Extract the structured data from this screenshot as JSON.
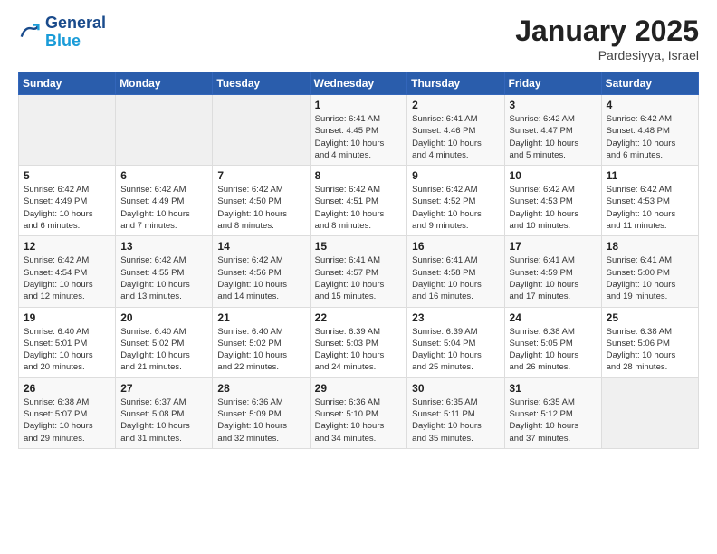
{
  "header": {
    "logo_line1": "General",
    "logo_line2": "Blue",
    "month_title": "January 2025",
    "subtitle": "Pardesiyya, Israel"
  },
  "weekdays": [
    "Sunday",
    "Monday",
    "Tuesday",
    "Wednesday",
    "Thursday",
    "Friday",
    "Saturday"
  ],
  "weeks": [
    [
      {
        "day": "",
        "info": ""
      },
      {
        "day": "",
        "info": ""
      },
      {
        "day": "",
        "info": ""
      },
      {
        "day": "1",
        "info": "Sunrise: 6:41 AM\nSunset: 4:45 PM\nDaylight: 10 hours\nand 4 minutes."
      },
      {
        "day": "2",
        "info": "Sunrise: 6:41 AM\nSunset: 4:46 PM\nDaylight: 10 hours\nand 4 minutes."
      },
      {
        "day": "3",
        "info": "Sunrise: 6:42 AM\nSunset: 4:47 PM\nDaylight: 10 hours\nand 5 minutes."
      },
      {
        "day": "4",
        "info": "Sunrise: 6:42 AM\nSunset: 4:48 PM\nDaylight: 10 hours\nand 6 minutes."
      }
    ],
    [
      {
        "day": "5",
        "info": "Sunrise: 6:42 AM\nSunset: 4:49 PM\nDaylight: 10 hours\nand 6 minutes."
      },
      {
        "day": "6",
        "info": "Sunrise: 6:42 AM\nSunset: 4:49 PM\nDaylight: 10 hours\nand 7 minutes."
      },
      {
        "day": "7",
        "info": "Sunrise: 6:42 AM\nSunset: 4:50 PM\nDaylight: 10 hours\nand 8 minutes."
      },
      {
        "day": "8",
        "info": "Sunrise: 6:42 AM\nSunset: 4:51 PM\nDaylight: 10 hours\nand 8 minutes."
      },
      {
        "day": "9",
        "info": "Sunrise: 6:42 AM\nSunset: 4:52 PM\nDaylight: 10 hours\nand 9 minutes."
      },
      {
        "day": "10",
        "info": "Sunrise: 6:42 AM\nSunset: 4:53 PM\nDaylight: 10 hours\nand 10 minutes."
      },
      {
        "day": "11",
        "info": "Sunrise: 6:42 AM\nSunset: 4:53 PM\nDaylight: 10 hours\nand 11 minutes."
      }
    ],
    [
      {
        "day": "12",
        "info": "Sunrise: 6:42 AM\nSunset: 4:54 PM\nDaylight: 10 hours\nand 12 minutes."
      },
      {
        "day": "13",
        "info": "Sunrise: 6:42 AM\nSunset: 4:55 PM\nDaylight: 10 hours\nand 13 minutes."
      },
      {
        "day": "14",
        "info": "Sunrise: 6:42 AM\nSunset: 4:56 PM\nDaylight: 10 hours\nand 14 minutes."
      },
      {
        "day": "15",
        "info": "Sunrise: 6:41 AM\nSunset: 4:57 PM\nDaylight: 10 hours\nand 15 minutes."
      },
      {
        "day": "16",
        "info": "Sunrise: 6:41 AM\nSunset: 4:58 PM\nDaylight: 10 hours\nand 16 minutes."
      },
      {
        "day": "17",
        "info": "Sunrise: 6:41 AM\nSunset: 4:59 PM\nDaylight: 10 hours\nand 17 minutes."
      },
      {
        "day": "18",
        "info": "Sunrise: 6:41 AM\nSunset: 5:00 PM\nDaylight: 10 hours\nand 19 minutes."
      }
    ],
    [
      {
        "day": "19",
        "info": "Sunrise: 6:40 AM\nSunset: 5:01 PM\nDaylight: 10 hours\nand 20 minutes."
      },
      {
        "day": "20",
        "info": "Sunrise: 6:40 AM\nSunset: 5:02 PM\nDaylight: 10 hours\nand 21 minutes."
      },
      {
        "day": "21",
        "info": "Sunrise: 6:40 AM\nSunset: 5:02 PM\nDaylight: 10 hours\nand 22 minutes."
      },
      {
        "day": "22",
        "info": "Sunrise: 6:39 AM\nSunset: 5:03 PM\nDaylight: 10 hours\nand 24 minutes."
      },
      {
        "day": "23",
        "info": "Sunrise: 6:39 AM\nSunset: 5:04 PM\nDaylight: 10 hours\nand 25 minutes."
      },
      {
        "day": "24",
        "info": "Sunrise: 6:38 AM\nSunset: 5:05 PM\nDaylight: 10 hours\nand 26 minutes."
      },
      {
        "day": "25",
        "info": "Sunrise: 6:38 AM\nSunset: 5:06 PM\nDaylight: 10 hours\nand 28 minutes."
      }
    ],
    [
      {
        "day": "26",
        "info": "Sunrise: 6:38 AM\nSunset: 5:07 PM\nDaylight: 10 hours\nand 29 minutes."
      },
      {
        "day": "27",
        "info": "Sunrise: 6:37 AM\nSunset: 5:08 PM\nDaylight: 10 hours\nand 31 minutes."
      },
      {
        "day": "28",
        "info": "Sunrise: 6:36 AM\nSunset: 5:09 PM\nDaylight: 10 hours\nand 32 minutes."
      },
      {
        "day": "29",
        "info": "Sunrise: 6:36 AM\nSunset: 5:10 PM\nDaylight: 10 hours\nand 34 minutes."
      },
      {
        "day": "30",
        "info": "Sunrise: 6:35 AM\nSunset: 5:11 PM\nDaylight: 10 hours\nand 35 minutes."
      },
      {
        "day": "31",
        "info": "Sunrise: 6:35 AM\nSunset: 5:12 PM\nDaylight: 10 hours\nand 37 minutes."
      },
      {
        "day": "",
        "info": ""
      }
    ]
  ]
}
